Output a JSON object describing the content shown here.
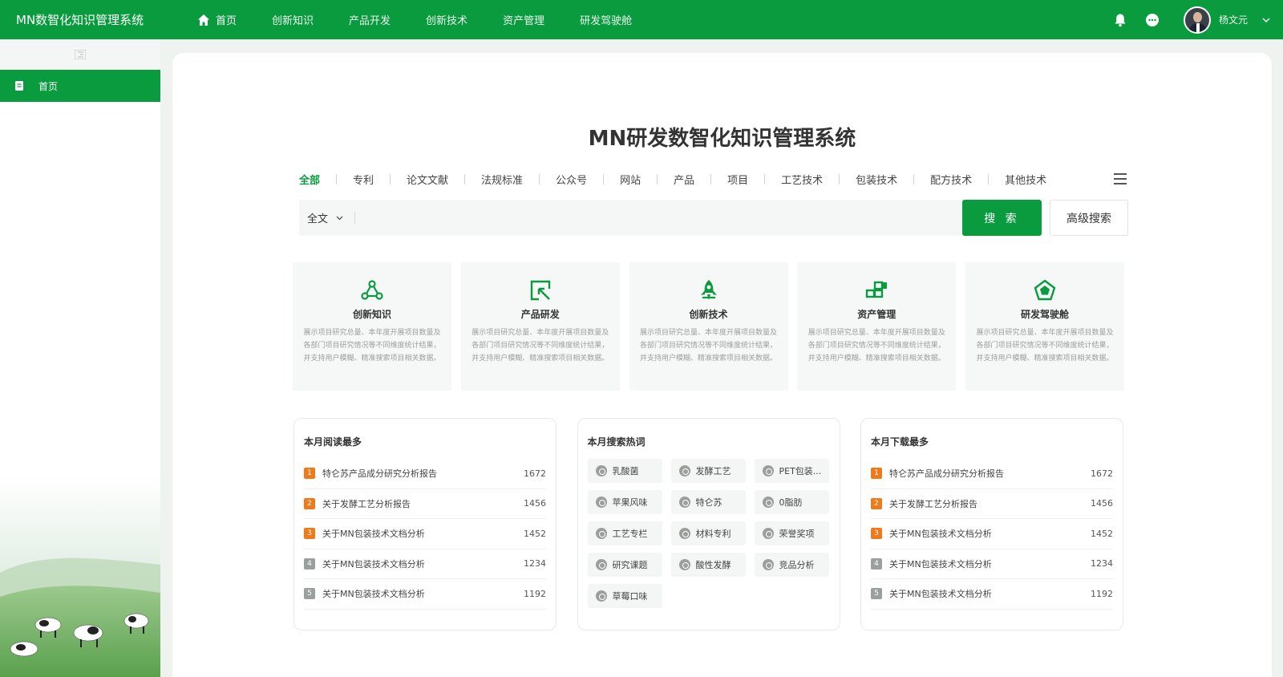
{
  "app": {
    "brand": "MN数智化知识管理系统",
    "nav": [
      {
        "label": "首页",
        "active": true,
        "icon": "home-icon"
      },
      {
        "label": "创新知识"
      },
      {
        "label": "产品开发"
      },
      {
        "label": "创新技术"
      },
      {
        "label": "资产管理"
      },
      {
        "label": "研发驾驶舱"
      }
    ],
    "user": {
      "name": "杨文元"
    },
    "colors": {
      "primary": "#0a9b3e",
      "rank_top": "#f07a1a",
      "rank_rest": "#9aa09d"
    }
  },
  "sidebar": {
    "items": [
      {
        "label": "首页",
        "icon": "document-icon"
      }
    ]
  },
  "main": {
    "title": "MN研发数智化知识管理系统",
    "tabs": [
      "全部",
      "专利",
      "论文文献",
      "法规标准",
      "公众号",
      "网站",
      "产品",
      "项目",
      "工艺技术",
      "包装技术",
      "配方技术",
      "其他技术"
    ],
    "search": {
      "scope": "全文",
      "value": "",
      "placeholder": "",
      "button": "搜 索",
      "advanced": "高级搜索"
    },
    "cards": [
      {
        "title": "创新知识",
        "icon": "network-nodes-icon",
        "desc": "展示项目研究总量、本年度开展项目数量及各部门项目研究情况等不同维度统计结果，并支持用户模糊、精准搜索项目相关数据。"
      },
      {
        "title": "产品研发",
        "icon": "cursor-select-icon",
        "desc": "展示项目研究总量、本年度开展项目数量及各部门项目研究情况等不同维度统计结果，并支持用户模糊、精准搜索项目相关数据。"
      },
      {
        "title": "创新技术",
        "icon": "rocket-icon",
        "desc": "展示项目研究总量、本年度开展项目数量及各部门项目研究情况等不同维度统计结果，并支持用户模糊、精准搜索项目相关数据。"
      },
      {
        "title": "资产管理",
        "icon": "blocks-icon",
        "desc": "展示项目研究总量、本年度开展项目数量及各部门项目研究情况等不同维度统计结果，并支持用户模糊、精准搜索项目相关数据。"
      },
      {
        "title": "研发驾驶舱",
        "icon": "pentagon-chart-icon",
        "desc": "展示项目研究总量、本年度开展项目数量及各部门项目研究情况等不同维度统计结果，并支持用户模糊、精准搜索项目相关数据。"
      }
    ],
    "most_read": {
      "title": "本月阅读最多",
      "items": [
        {
          "rank": "1",
          "title": "特仑苏产品成分研究分析报告",
          "count": "1672"
        },
        {
          "rank": "2",
          "title": "关于发酵工艺分析报告",
          "count": "1456"
        },
        {
          "rank": "3",
          "title": "关于MN包装技术文档分析",
          "count": "1452"
        },
        {
          "rank": "4",
          "title": "关于MN包装技术文档分析",
          "count": "1234"
        },
        {
          "rank": "5",
          "title": "关于MN包装技术文档分析",
          "count": "1192"
        }
      ]
    },
    "hot_search": {
      "title": "本月搜索热词",
      "tags": [
        "乳酸菌",
        "发酵工艺",
        "PET包装...",
        "苹果风味",
        "特仑苏",
        "0脂肪",
        "工艺专栏",
        "材料专利",
        "荣誉奖项",
        "研究课题",
        "酸性发酵",
        "竞品分析",
        "草莓口味"
      ]
    },
    "most_downloaded": {
      "title": "本月下载最多",
      "items": [
        {
          "rank": "1",
          "title": "特仑苏产品成分研究分析报告",
          "count": "1672"
        },
        {
          "rank": "2",
          "title": "关于发酵工艺分析报告",
          "count": "1456"
        },
        {
          "rank": "3",
          "title": "关于MN包装技术文档分析",
          "count": "1452"
        },
        {
          "rank": "4",
          "title": "关于MN包装技术文档分析",
          "count": "1234"
        },
        {
          "rank": "5",
          "title": "关于MN包装技术文档分析",
          "count": "1192"
        }
      ]
    }
  }
}
